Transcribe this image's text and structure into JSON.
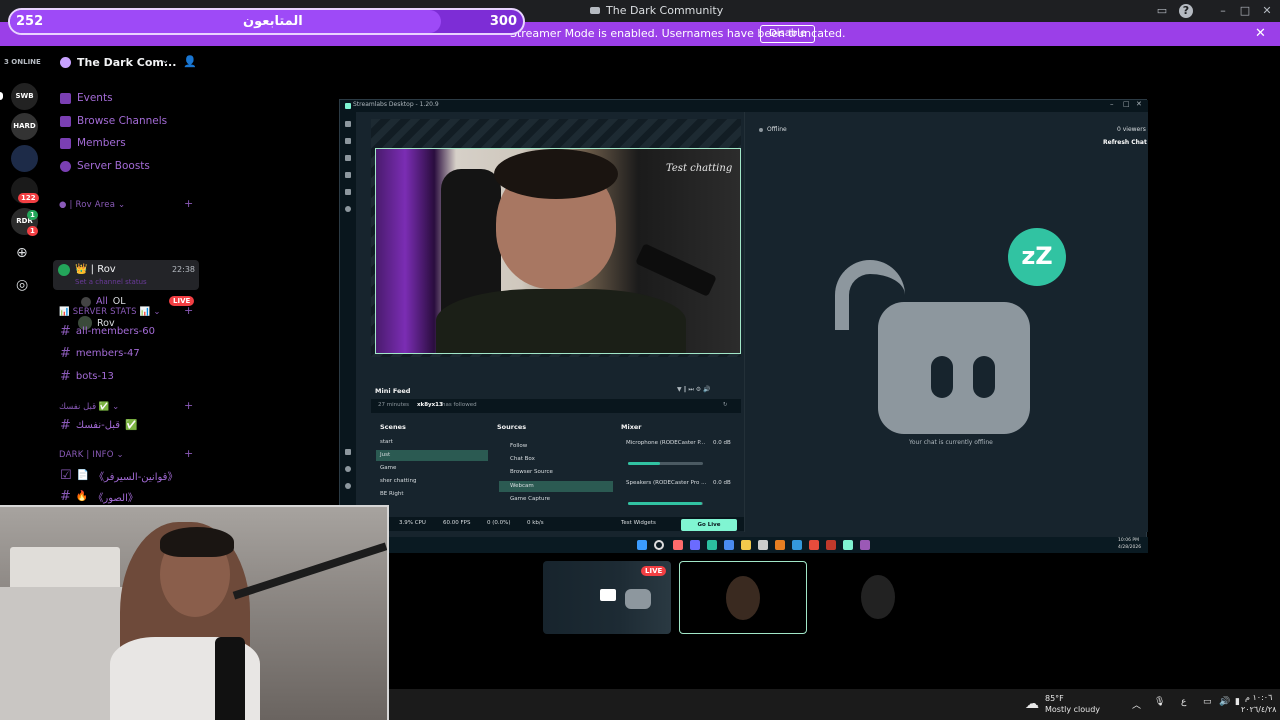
{
  "window": {
    "title": "The Dark Community"
  },
  "banner": {
    "message": "Streamer Mode is enabled. Usernames have been truncated.",
    "disable_label": "Disable"
  },
  "goal": {
    "current": "252",
    "label": "المتابعون",
    "target": "300",
    "progress": 0.84
  },
  "rail": {
    "online_label": "3 ONLINE",
    "servers": [
      "SWB",
      "HARD",
      "",
      "",
      "RDR"
    ],
    "badges": [
      "122",
      "1",
      "1"
    ]
  },
  "sidebar": {
    "server_name": "The Dark Com...",
    "nav": [
      "Events",
      "Browse Channels",
      "Members",
      "Server Boosts"
    ],
    "categories": {
      "rov_area": "| Rov Area",
      "server_stats": "SERVER STATS",
      "arabic_cat": "قبل نفسك",
      "dark_info": "DARK | INFO"
    },
    "voice": {
      "name": "| Rov",
      "time": "22:38",
      "status": "Set a channel status"
    },
    "voice_users": [
      {
        "name": "All",
        "tag": "OL",
        "live": "LIVE"
      },
      {
        "name": "Rov"
      }
    ],
    "stat_channels": [
      "all-members-60",
      "members-47",
      "bots-13"
    ],
    "arabic_channel": "قبل-نفسك",
    "info_channels": [
      "《قوانين-السيرفر》",
      "《الصور》"
    ]
  },
  "streamlabs": {
    "title": "Streamlabs Desktop - 1.20.9",
    "signature": "Test chatting",
    "minifeed": {
      "header": "Mini Feed",
      "time": "27 minutes",
      "user": "xk8yx13",
      "action": "has followed"
    },
    "scenes_header": "Scenes",
    "scenes": [
      "start",
      "Just",
      "Game",
      "sher chatting",
      "BE Right"
    ],
    "sources_header": "Sources",
    "sources": [
      "Follow",
      "Chat Box",
      "Browser Source",
      "Webcam",
      "Game Capture"
    ],
    "mixer_header": "Mixer",
    "mixer": [
      {
        "name": "Microphone (RODECaster P...",
        "db": "0.0 dB",
        "level": 0.42
      },
      {
        "name": "Speakers (RODECaster Pro ...",
        "db": "0.0 dB",
        "level": 0.98
      }
    ],
    "footer": {
      "cpu": "3.9% CPU",
      "fps": "60.00 FPS",
      "dropped": "0 (0.0%)",
      "kbps": "0 kb/s",
      "test_widgets": "Test Widgets",
      "go_live": "Go Live"
    },
    "chat": {
      "status": "Offline",
      "viewers": "0 viewers",
      "refresh": "Refresh Chat",
      "offline_msg": "Your chat is currently offline",
      "zz": "zZ"
    },
    "clock": {
      "time": "10:06 PM",
      "date": "4/28/2026"
    }
  },
  "thumbs": {
    "live_label": "LIVE"
  },
  "taskbar": {
    "temp": "85°F",
    "weather": "Mostly cloudy",
    "lang": "ع",
    "time": "١٠:٠٦ م",
    "date": "٢٠٢٦/٤/٢٨"
  },
  "colors": {
    "accent": "#9b3fe8",
    "live": "#f23f43",
    "streamlabs": "#80f5d2"
  }
}
